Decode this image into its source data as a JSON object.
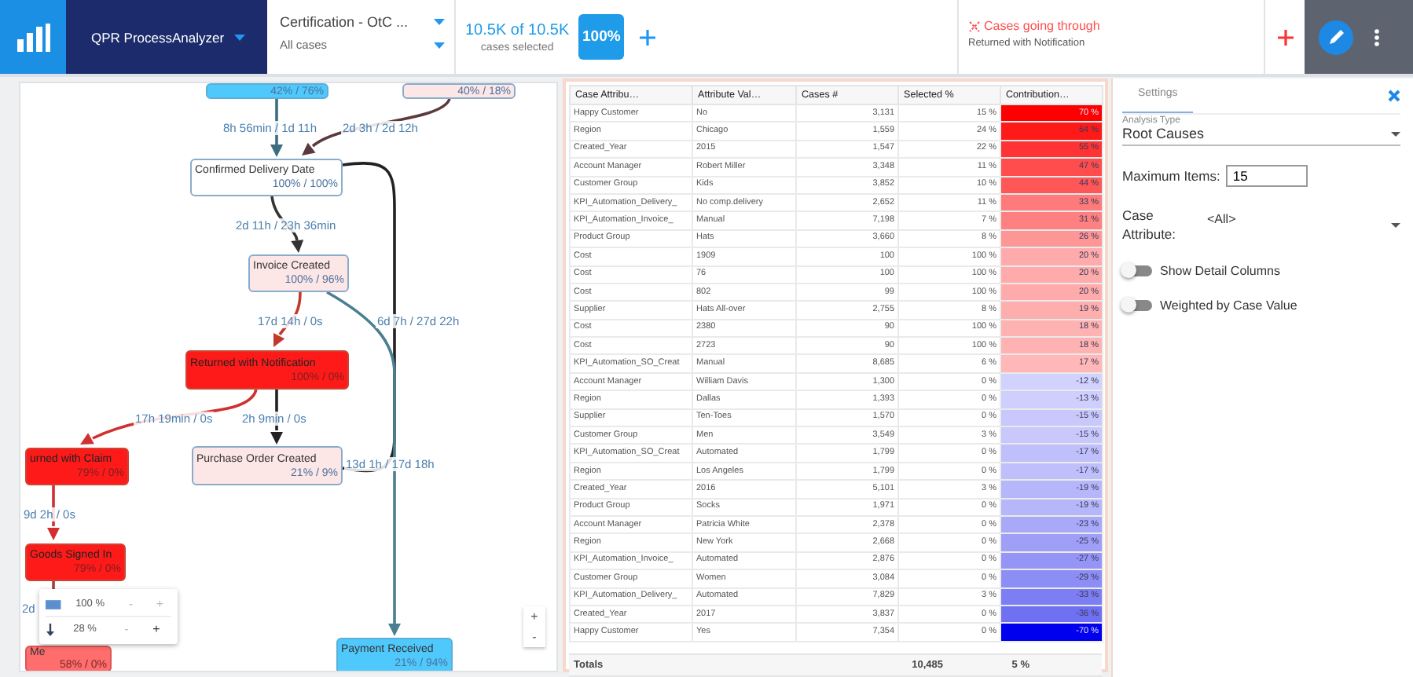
{
  "header": {
    "app_name": "QPR ProcessAnalyzer",
    "model": "Certification - OtC ...",
    "filter": "All cases",
    "case_count": "10.5K of 10.5K",
    "case_caption": "cases selected",
    "badge": "100%",
    "filter_chip": {
      "title": "Cases going through",
      "subtitle": "Returned with Notification"
    }
  },
  "process_map": {
    "nodes": [
      {
        "stats": "42% / 76%",
        "kind": "blue"
      },
      {
        "stats": "40% / 18%",
        "kind": "pink"
      },
      {
        "label": "Confirmed Delivery Date",
        "stats": "100% / 100%",
        "kind": "white"
      },
      {
        "label": "Invoice Created",
        "stats": "100% / 96%",
        "kind": "pink"
      },
      {
        "label": "Returned with Notification",
        "stats": "100% / 0%",
        "kind": "red"
      },
      {
        "label": "urned with Claim",
        "stats": "79% / 0%",
        "kind": "red"
      },
      {
        "label": "Purchase Order Created",
        "stats": "21% / 9%",
        "kind": "pink"
      },
      {
        "label": "Goods Signed In",
        "stats": "79% / 0%",
        "kind": "red"
      },
      {
        "label": "Me",
        "stats": "58% / 0%",
        "kind": "salmon"
      },
      {
        "label": "Payment Received",
        "stats": "21% / 94%",
        "kind": "blue"
      }
    ],
    "edges": [
      {
        "label": "8h 56min / 1d 11h"
      },
      {
        "label": "2d 3h / 2d 12h"
      },
      {
        "label": "13d 1h / 17d 18h"
      },
      {
        "label": "2d 11h / 23h 36min"
      },
      {
        "label": "17d 14h / 0s"
      },
      {
        "label": "6d 7h / 27d 22h"
      },
      {
        "label": "17h 19min / 0s"
      },
      {
        "label": "2h 9min / 0s"
      },
      {
        "label": "9d 2h / 0s"
      },
      {
        "label": "2d"
      }
    ],
    "legend": [
      {
        "kind": "node_size",
        "value": "100 %",
        "minus": {
          "label": "-",
          "disabled": true
        },
        "plus": {
          "label": "+",
          "disabled": true
        }
      },
      {
        "kind": "edge_width",
        "value": "28 %",
        "minus": {
          "label": "-",
          "disabled": true
        },
        "plus": {
          "label": "+",
          "disabled": false
        }
      }
    ],
    "zoom": [
      "+",
      "-"
    ]
  },
  "table": {
    "columns": [
      "Case Attribu…",
      "Attribute Val…",
      "Cases #",
      "Selected %",
      "Contribution…"
    ],
    "rows": [
      {
        "cells": [
          "Happy Customer",
          "No",
          "3,131",
          "15 %",
          "70 %"
        ],
        "color": "#ff0000"
      },
      {
        "cells": [
          "Region",
          "Chicago",
          "1,559",
          "24 %",
          "64 %"
        ],
        "color": "#ff1a1a"
      },
      {
        "cells": [
          "Created_Year",
          "2015",
          "1,547",
          "22 %",
          "55 %"
        ],
        "color": "#ff3333"
      },
      {
        "cells": [
          "Account Manager",
          "Robert Miller",
          "3,348",
          "11 %",
          "47 %"
        ],
        "color": "#ff4d4d"
      },
      {
        "cells": [
          "Customer Group",
          "Kids",
          "3,852",
          "10 %",
          "44 %"
        ],
        "color": "#ff5757"
      },
      {
        "cells": [
          "KPI_Automation_Delivery_",
          "No comp.delivery",
          "2,652",
          "11 %",
          "33 %"
        ],
        "color": "#ff7a7a"
      },
      {
        "cells": [
          "KPI_Automation_Invoice_",
          "Manual",
          "7,198",
          "7 %",
          "31 %"
        ],
        "color": "#ff8080"
      },
      {
        "cells": [
          "Product Group",
          "Hats",
          "3,660",
          "8 %",
          "26 %"
        ],
        "color": "#ff9696"
      },
      {
        "cells": [
          "Cost",
          "1909",
          "100",
          "100 %",
          "20 %"
        ],
        "color": "#ffabab"
      },
      {
        "cells": [
          "Cost",
          "76",
          "100",
          "100 %",
          "20 %"
        ],
        "color": "#ffabab"
      },
      {
        "cells": [
          "Cost",
          "802",
          "99",
          "100 %",
          "20 %"
        ],
        "color": "#ffabab"
      },
      {
        "cells": [
          "Supplier",
          "Hats All-over",
          "2,755",
          "8 %",
          "19 %"
        ],
        "color": "#ffaeae"
      },
      {
        "cells": [
          "Cost",
          "2380",
          "90",
          "100 %",
          "18 %"
        ],
        "color": "#ffb2b2"
      },
      {
        "cells": [
          "Cost",
          "2723",
          "90",
          "100 %",
          "18 %"
        ],
        "color": "#ffb2b2"
      },
      {
        "cells": [
          "KPI_Automation_SO_Creat",
          "Manual",
          "8,685",
          "6 %",
          "17 %"
        ],
        "color": "#ffb7b7"
      },
      {
        "cells": [
          "Account Manager",
          "William Davis",
          "1,300",
          "0 %",
          "-12 %"
        ],
        "color": "#d2d2ff"
      },
      {
        "cells": [
          "Region",
          "Dallas",
          "1,393",
          "0 %",
          "-13 %"
        ],
        "color": "#cfcffd"
      },
      {
        "cells": [
          "Supplier",
          "Ten-Toes",
          "1,570",
          "0 %",
          "-15 %"
        ],
        "color": "#c8c8fc"
      },
      {
        "cells": [
          "Customer Group",
          "Men",
          "3,549",
          "3 %",
          "-15 %"
        ],
        "color": "#c8c8fc"
      },
      {
        "cells": [
          "KPI_Automation_SO_Creat",
          "Automated",
          "1,799",
          "0 %",
          "-17 %"
        ],
        "color": "#bfbffc"
      },
      {
        "cells": [
          "Region",
          "Los Angeles",
          "1,799",
          "0 %",
          "-17 %"
        ],
        "color": "#bfbffc"
      },
      {
        "cells": [
          "Created_Year",
          "2016",
          "5,101",
          "3 %",
          "-19 %"
        ],
        "color": "#b6b6fa"
      },
      {
        "cells": [
          "Product Group",
          "Socks",
          "1,971",
          "0 %",
          "-19 %"
        ],
        "color": "#b6b6fa"
      },
      {
        "cells": [
          "Account Manager",
          "Patricia White",
          "2,378",
          "0 %",
          "-23 %"
        ],
        "color": "#a9a9fa"
      },
      {
        "cells": [
          "Region",
          "New York",
          "2,668",
          "0 %",
          "-25 %"
        ],
        "color": "#9f9ff8"
      },
      {
        "cells": [
          "KPI_Automation_Invoice_",
          "Automated",
          "2,876",
          "0 %",
          "-27 %"
        ],
        "color": "#9595f8"
      },
      {
        "cells": [
          "Customer Group",
          "Women",
          "3,084",
          "0 %",
          "-29 %"
        ],
        "color": "#8d8df6"
      },
      {
        "cells": [
          "KPI_Automation_Delivery_",
          "Automated",
          "7,829",
          "3 %",
          "-33 %"
        ],
        "color": "#7d7df4"
      },
      {
        "cells": [
          "Created_Year",
          "2017",
          "3,837",
          "0 %",
          "-36 %"
        ],
        "color": "#7070f2"
      },
      {
        "cells": [
          "Happy Customer",
          "Yes",
          "7,354",
          "0 %",
          "-70 %"
        ],
        "color": "#0000ee"
      }
    ],
    "totals": {
      "label": "Totals",
      "cases": "10,485",
      "selected": "5 %"
    }
  },
  "settings": {
    "tab": {
      "label": "Settings",
      "selected": true
    },
    "analysis_type": {
      "label": "Analysis Type",
      "value": "Root Causes"
    },
    "max_items": {
      "label": "Maximum Items:",
      "value": "15"
    },
    "case_attribute": {
      "label": "Case Attribute:",
      "value": "<All>"
    },
    "toggles": [
      {
        "label": "Show Detail Columns",
        "on": false
      },
      {
        "label": "Weighted by Case Value",
        "on": false
      }
    ]
  }
}
